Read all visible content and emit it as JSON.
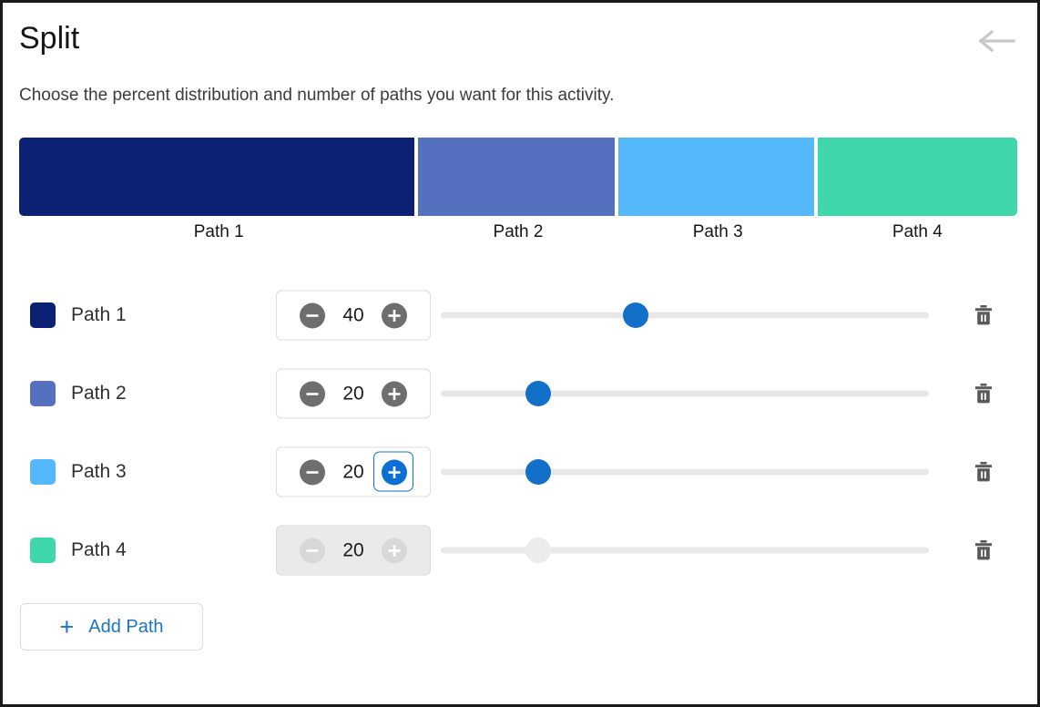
{
  "header": {
    "title": "Split",
    "back_icon": "arrow-left-icon",
    "subtitle": "Choose the percent distribution and number of paths you want for this activity."
  },
  "distribution": {
    "segments": [
      {
        "label": "Path 1",
        "percent": 40,
        "color": "#0c2074"
      },
      {
        "label": "Path 2",
        "percent": 20,
        "color": "#5570bf"
      },
      {
        "label": "Path 3",
        "percent": 20,
        "color": "#53b9fb"
      },
      {
        "label": "Path 4",
        "percent": 20,
        "color": "#3fd6ab"
      }
    ]
  },
  "rows": [
    {
      "label": "Path 1",
      "color": "#0c2074",
      "value": 40,
      "decrement_icon": "minus-circle-icon",
      "increment_icon": "plus-circle-icon",
      "delete_icon": "trash-icon",
      "disabled": false,
      "increment_focused": false
    },
    {
      "label": "Path 2",
      "color": "#5570bf",
      "value": 20,
      "decrement_icon": "minus-circle-icon",
      "increment_icon": "plus-circle-icon",
      "delete_icon": "trash-icon",
      "disabled": false,
      "increment_focused": false
    },
    {
      "label": "Path 3",
      "color": "#53b9fb",
      "value": 20,
      "decrement_icon": "minus-circle-icon",
      "increment_icon": "plus-circle-icon",
      "delete_icon": "trash-icon",
      "disabled": false,
      "increment_focused": true
    },
    {
      "label": "Path 4",
      "color": "#3fd6ab",
      "value": 20,
      "decrement_icon": "minus-circle-icon",
      "increment_icon": "plus-circle-icon",
      "delete_icon": "trash-icon",
      "disabled": true,
      "increment_focused": false
    }
  ],
  "add_path": {
    "label": "Add Path",
    "plus": "+",
    "icon": "plus-icon"
  },
  "colors": {
    "accent_blue": "#1270c8",
    "focus_blue": "#0b6fd4",
    "link_blue": "#1b73c4",
    "track_gray": "#e8e8e8",
    "step_gray": "#6e6e6e",
    "disabled_bg": "#eaeaea"
  },
  "slider": {
    "min": 0,
    "max": 100
  }
}
